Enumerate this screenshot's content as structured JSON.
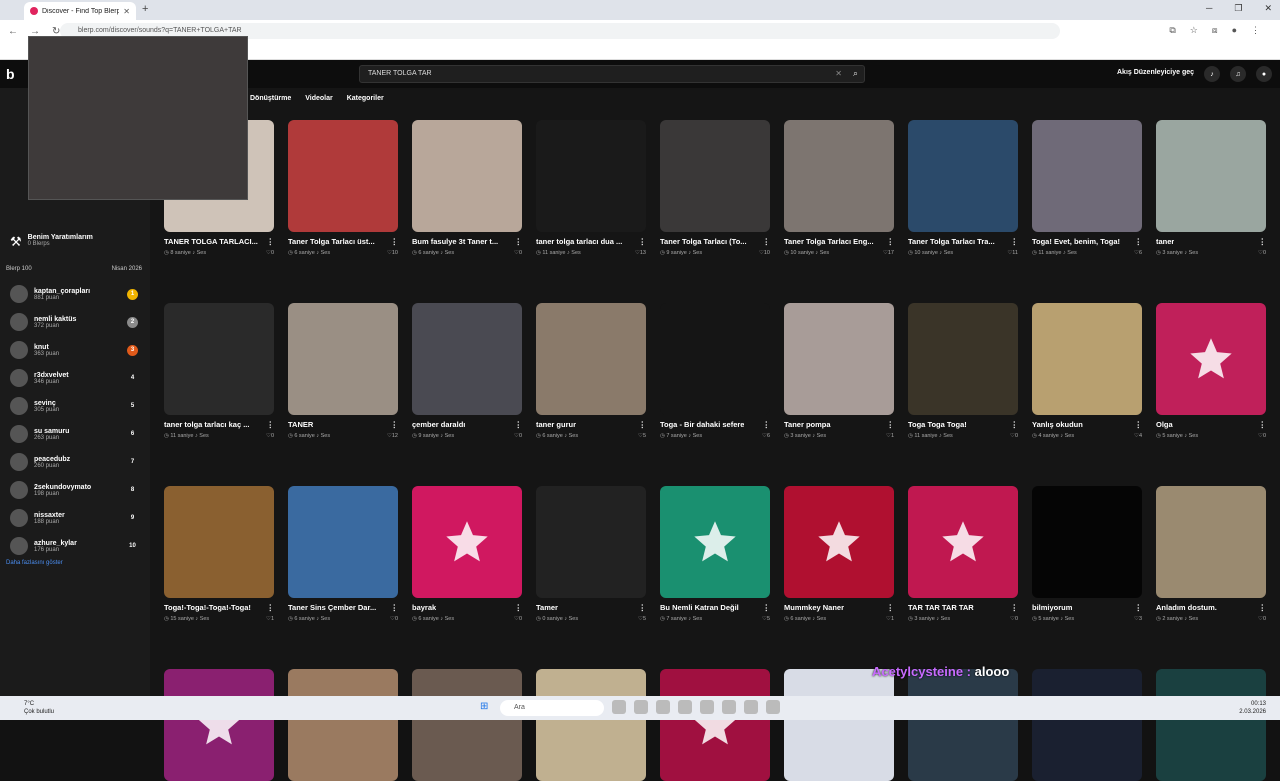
{
  "browser": {
    "tab_title": "Discover - Find Top Blerps, Stre...",
    "url": "blerp.com/discover/sounds?q=TANER+TOLGA+TAR"
  },
  "topbar": {
    "search_value": "TANER TOLGA TAR",
    "creator_button": "Akış Düzenleyiciye geç"
  },
  "filters": [
    "Dönüştürme",
    "Videolar",
    "Kategoriler"
  ],
  "sidebar": {
    "my_creations": "Benim Yaratımlarım",
    "my_creations_sub": "0 Blerps",
    "leaderboard_title": "Blerp 100",
    "leaderboard_date": "Nisan 2026",
    "leaderboard": [
      {
        "name": "kaptan_çorapları",
        "points": "881 puan",
        "rank": "1",
        "color": "#f0b400"
      },
      {
        "name": "nemli kaktüs",
        "points": "372 puan",
        "rank": "2",
        "color": "#8a8a8a"
      },
      {
        "name": "knut",
        "points": "363 puan",
        "rank": "3",
        "color": "#e05a1a"
      },
      {
        "name": "r3dxvelvet",
        "points": "346 puan",
        "rank": "4",
        "color": "transparent"
      },
      {
        "name": "sevinç",
        "points": "305 puan",
        "rank": "5",
        "color": "transparent"
      },
      {
        "name": "su samuru",
        "points": "263 puan",
        "rank": "6",
        "color": "transparent"
      },
      {
        "name": "peacedubz",
        "points": "260 puan",
        "rank": "7",
        "color": "transparent"
      },
      {
        "name": "2sekundovymato",
        "points": "198 puan",
        "rank": "8",
        "color": "transparent"
      },
      {
        "name": "nissaxter",
        "points": "188 puan",
        "rank": "9",
        "color": "transparent"
      },
      {
        "name": "azhure_kylar",
        "points": "176 puan",
        "rank": "10",
        "color": "transparent"
      }
    ],
    "more_link": "Daha fazlasını göster"
  },
  "cards": [
    {
      "title": "TANER TOLGA TARLACI...",
      "duration": "8 saniye",
      "type": "Ses",
      "likes": "0",
      "bg": "#cfc3b8",
      "star": false
    },
    {
      "title": "Taner Tolga Tarlacı üst...",
      "duration": "6 saniye",
      "type": "Ses",
      "likes": "10",
      "bg": "#b03a3a",
      "star": false
    },
    {
      "title": "Bum fasulye 3t Taner t...",
      "duration": "6 saniye",
      "type": "Ses",
      "likes": "0",
      "bg": "#b8a79a",
      "star": false
    },
    {
      "title": "taner tolga tarlacı dua ...",
      "duration": "11 saniye",
      "type": "Ses",
      "likes": "13",
      "bg": "#1a1a1a",
      "star": false
    },
    {
      "title": "Taner Tolga Tarlacı (To...",
      "duration": "9 saniye",
      "type": "Ses",
      "likes": "10",
      "bg": "#3a3838",
      "star": false
    },
    {
      "title": "Taner Tolga Tarlacı Eng...",
      "duration": "10 saniye",
      "type": "Ses",
      "likes": "17",
      "bg": "#7d7570",
      "star": false
    },
    {
      "title": "Taner Tolga Tarlacı Tra...",
      "duration": "10 saniye",
      "type": "Ses",
      "likes": "11",
      "bg": "#2b4a6a",
      "star": false
    },
    {
      "title": "Toga! Evet, benim, Toga!",
      "duration": "11 saniye",
      "type": "Ses",
      "likes": "6",
      "bg": "#6f6a78",
      "star": false
    },
    {
      "title": "taner",
      "duration": "3 saniye",
      "type": "Ses",
      "likes": "0",
      "bg": "#9aa6a0",
      "star": false
    },
    {
      "title": "taner tolga tarlacı kaç ...",
      "duration": "11 saniye",
      "type": "Ses",
      "likes": "0",
      "bg": "#2a2a2a",
      "star": false
    },
    {
      "title": "TANER",
      "duration": "6 saniye",
      "type": "Ses",
      "likes": "12",
      "bg": "#9a8f84",
      "star": false
    },
    {
      "title": "çember daraldı",
      "duration": "9 saniye",
      "type": "Ses",
      "likes": "0",
      "bg": "#4a4a52",
      "star": false
    },
    {
      "title": "taner gurur",
      "duration": "6 saniye",
      "type": "Ses",
      "likes": "5",
      "bg": "#8a7a6a",
      "star": false
    },
    {
      "title": "Toga - Bir dahaki sefere",
      "duration": "7 saniye",
      "type": "Ses",
      "likes": "6",
      "bg": "#151515",
      "star": false
    },
    {
      "title": "Taner pompa",
      "duration": "3 saniye",
      "type": "Ses",
      "likes": "1",
      "bg": "#a89c98",
      "star": false
    },
    {
      "title": "Toga Toga Toga!",
      "duration": "11 saniye",
      "type": "Ses",
      "likes": "0",
      "bg": "#3a3428",
      "star": false
    },
    {
      "title": "Yanlış okudun",
      "duration": "4 saniye",
      "type": "Ses",
      "likes": "4",
      "bg": "#b8a070",
      "star": false
    },
    {
      "title": "Olga",
      "duration": "5 saniye",
      "type": "Ses",
      "likes": "0",
      "bg": "#c0205a",
      "star": true
    },
    {
      "title": "Toga!-Toga!-Toga!-Toga!",
      "duration": "15 saniye",
      "type": "Ses",
      "likes": "1",
      "bg": "#8a6030",
      "star": false
    },
    {
      "title": "Taner Sins Çember Dar...",
      "duration": "6 saniye",
      "type": "Ses",
      "likes": "0",
      "bg": "#3a6aa0",
      "star": false
    },
    {
      "title": "bayrak",
      "duration": "6 saniye",
      "type": "Ses",
      "likes": "0",
      "bg": "#d01860",
      "star": true
    },
    {
      "title": "Tamer",
      "duration": "0 saniye",
      "type": "Ses",
      "likes": "5",
      "bg": "#222222",
      "star": false
    },
    {
      "title": "Bu Nemli Katran Değil",
      "duration": "7 saniye",
      "type": "Ses",
      "likes": "5",
      "bg": "#1a9070",
      "star": true
    },
    {
      "title": "Mummkey Naner",
      "duration": "6 saniye",
      "type": "Ses",
      "likes": "1",
      "bg": "#b01030",
      "star": true
    },
    {
      "title": "TAR TAR TAR TAR",
      "duration": "3 saniye",
      "type": "Ses",
      "likes": "0",
      "bg": "#c01850",
      "star": true
    },
    {
      "title": "bilmiyorum",
      "duration": "5 saniye",
      "type": "Ses",
      "likes": "3",
      "bg": "#050505",
      "star": false
    },
    {
      "title": "Anladım dostum.",
      "duration": "2 saniye",
      "type": "Ses",
      "likes": "0",
      "bg": "#9a8a70",
      "star": false
    },
    {
      "title": "",
      "duration": "",
      "type": "",
      "likes": "",
      "bg": "#8a2070",
      "star": true
    },
    {
      "title": "",
      "duration": "",
      "type": "",
      "likes": "",
      "bg": "#9a7a60",
      "star": false
    },
    {
      "title": "",
      "duration": "",
      "type": "",
      "likes": "",
      "bg": "#6a5a50",
      "star": false
    },
    {
      "title": "",
      "duration": "",
      "type": "",
      "likes": "",
      "bg": "#c0b090",
      "star": false
    },
    {
      "title": "",
      "duration": "",
      "type": "",
      "likes": "",
      "bg": "#a01040",
      "star": true
    },
    {
      "title": "",
      "duration": "",
      "type": "",
      "likes": "",
      "bg": "#d8dce6",
      "star": false
    },
    {
      "title": "",
      "duration": "",
      "type": "",
      "likes": "",
      "bg": "#2a3a48",
      "star": false
    },
    {
      "title": "",
      "duration": "",
      "type": "",
      "likes": "",
      "bg": "#1a2030",
      "star": false
    },
    {
      "title": "",
      "duration": "",
      "type": "",
      "likes": "",
      "bg": "#1a4040",
      "star": false
    }
  ],
  "chat_overlay": {
    "user": "Acetylcysteine",
    "message": "alooo"
  },
  "taskbar": {
    "weather_temp": "7°C",
    "weather_desc": "Çok bulutlu",
    "search": "Ara",
    "time": "00:13",
    "date": "2.03.2026"
  }
}
